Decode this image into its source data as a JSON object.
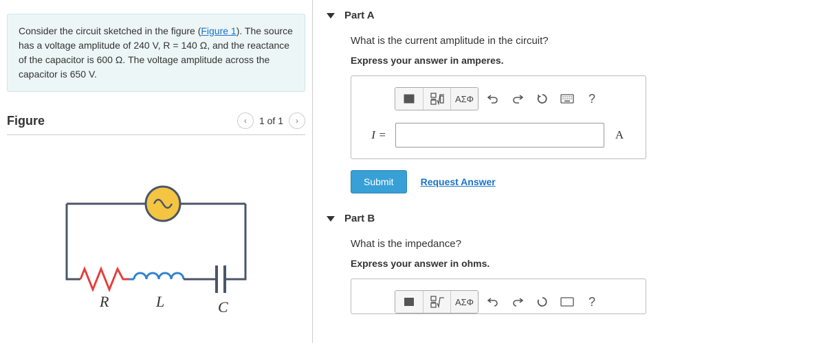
{
  "problem": {
    "text_before_link": "Consider the circuit sketched in the figure (",
    "link_text": "Figure 1",
    "text_after_link": "). The source has a voltage amplitude of 240 V, R = 140 Ω, and the reactance of the capacitor is 600 Ω. The voltage amplitude across the capacitor is 650 V."
  },
  "figure": {
    "title": "Figure",
    "pager": "1 of 1",
    "labels": {
      "R": "R",
      "L": "L",
      "C": "C"
    }
  },
  "partA": {
    "label": "Part A",
    "question": "What is the current amplitude in the circuit?",
    "instruction": "Express your answer in amperes.",
    "var_label": "I =",
    "unit": "A",
    "toolbar": {
      "templates": "x√",
      "greek": "ΑΣΦ",
      "help": "?"
    },
    "submit": "Submit",
    "request": "Request Answer"
  },
  "partB": {
    "label": "Part B",
    "question": "What is the impedance?",
    "instruction": "Express your answer in ohms.",
    "toolbar": {
      "greek": "ΑΣΦ"
    }
  }
}
